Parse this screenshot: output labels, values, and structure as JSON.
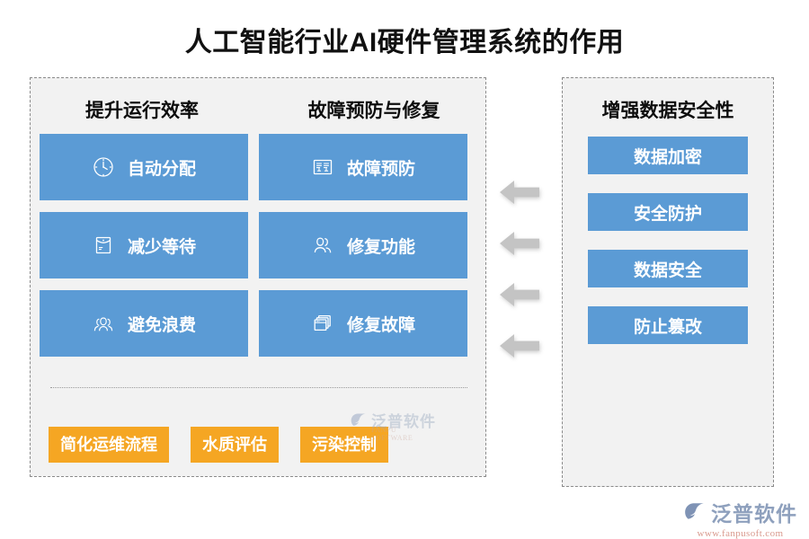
{
  "title": "人工智能行业AI硬件管理系统的作用",
  "colors": {
    "card_blue": "#5b9bd5",
    "tag_orange": "#f5a623",
    "panel_bg": "#f2f2f2",
    "panel_border": "#8a8a8a",
    "arrow_gray": "#c4c4c4",
    "title_text": "#111111"
  },
  "left_panel": {
    "headings": [
      {
        "label": "提升运行效率"
      },
      {
        "label": "故障预防与修复"
      }
    ],
    "cards": [
      {
        "label": "自动分配",
        "icon": "clock-icon"
      },
      {
        "label": "故障预防",
        "icon": "dashboard-icon"
      },
      {
        "label": "减少等待",
        "icon": "envelope-icon"
      },
      {
        "label": "修复功能",
        "icon": "users-icon"
      },
      {
        "label": "避免浪费",
        "icon": "group-icon"
      },
      {
        "label": "修复故障",
        "icon": "windows-stack-icon"
      }
    ],
    "tags": [
      {
        "label": "简化运维流程"
      },
      {
        "label": "水质评估"
      },
      {
        "label": "污染控制"
      }
    ]
  },
  "right_panel": {
    "heading": "增强数据安全性",
    "pills": [
      {
        "label": "数据加密"
      },
      {
        "label": "安全防护"
      },
      {
        "label": "数据安全"
      },
      {
        "label": "防止篡改"
      }
    ]
  },
  "arrows": {
    "count": 4,
    "direction": "left"
  },
  "brand": {
    "name": "泛普软件",
    "url": "www.fanpusoft.com"
  },
  "watermark": {
    "name": "泛普软件",
    "url": "FANPU SOFTWARE"
  }
}
